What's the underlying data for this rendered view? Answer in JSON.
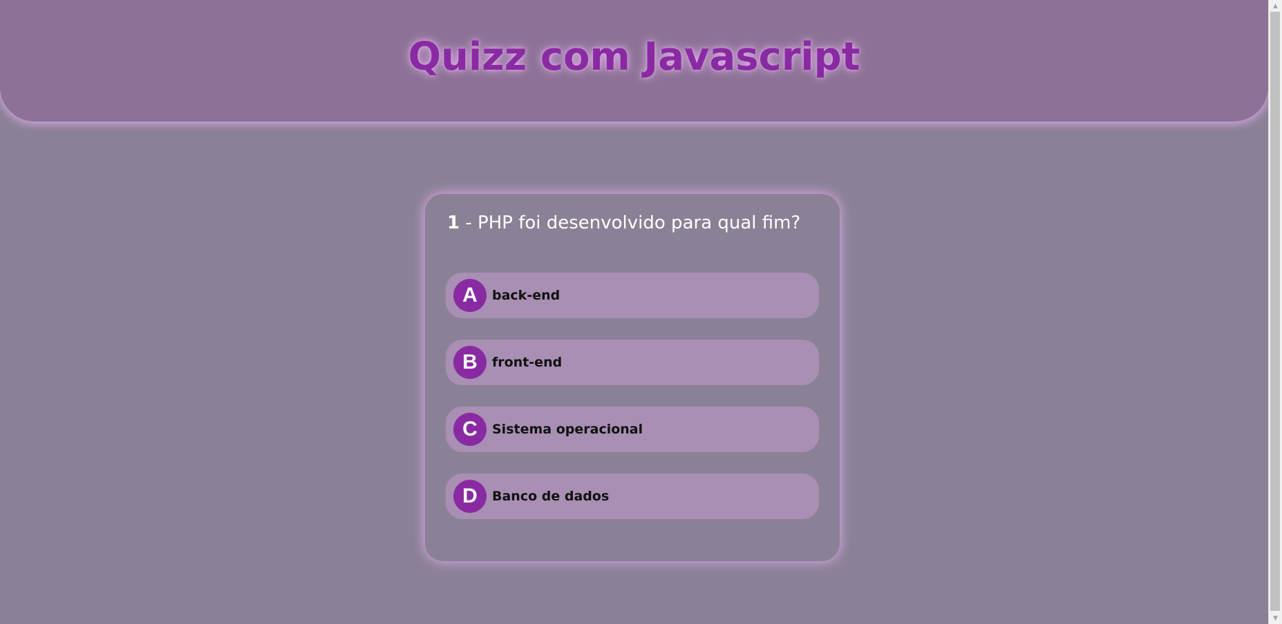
{
  "header": {
    "title": "Quizz com Javascript"
  },
  "question": {
    "number": "1",
    "separator": " - ",
    "text": "PHP foi desenvolvido para qual fim?"
  },
  "answers": [
    {
      "letter": "A",
      "text": "back-end"
    },
    {
      "letter": "B",
      "text": "front-end"
    },
    {
      "letter": "C",
      "text": "Sistema operacional"
    },
    {
      "letter": "D",
      "text": "Banco de dados"
    }
  ],
  "scrollbar": {
    "up_icon": "chevron-up-icon",
    "down_icon": "chevron-down-icon"
  },
  "colors": {
    "background": "#8b8196",
    "header": "#8d7196",
    "accent": "#8a2aa3",
    "answer_bg": "#a98fb4",
    "glow": "#e6aff5"
  }
}
